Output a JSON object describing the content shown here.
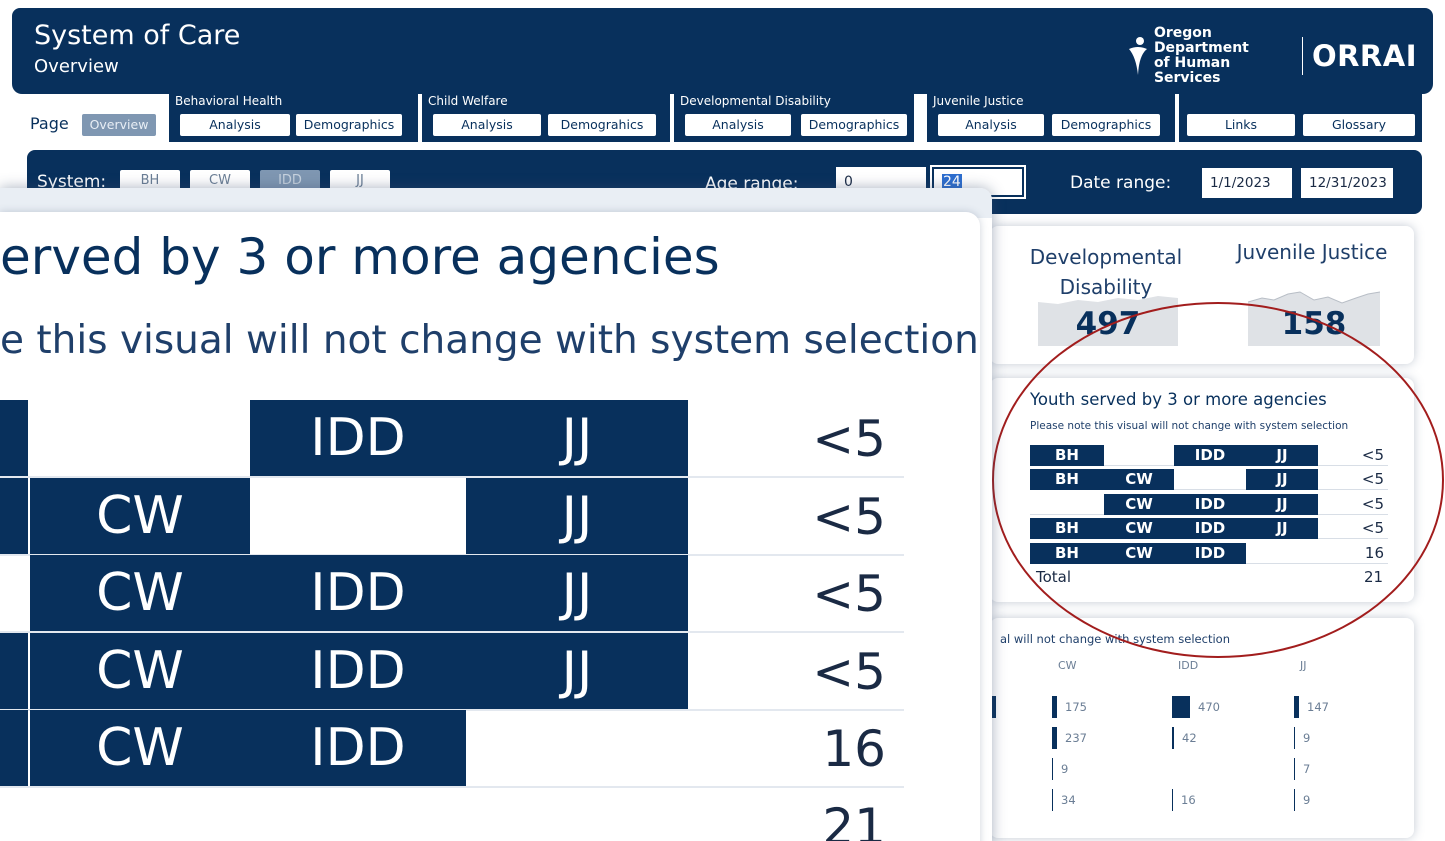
{
  "header": {
    "title": "System of Care",
    "subtitle": "Overview",
    "agency_line1": "Oregon Department",
    "agency_line2": "of Human Services",
    "brand": "ORRAI"
  },
  "nav": {
    "page_label": "Page",
    "overview": "Overview",
    "groups": [
      {
        "label": "Behavioral Health",
        "buttons": [
          "Analysis",
          "Demographics"
        ]
      },
      {
        "label": "Child Welfare",
        "buttons": [
          "Analysis",
          "Demograhics"
        ]
      },
      {
        "label": "Developmental Disability",
        "buttons": [
          "Analysis",
          "Demographics"
        ]
      },
      {
        "label": "Juvenile Justice",
        "buttons": [
          "Analysis",
          "Demographics"
        ]
      }
    ],
    "links": "Links",
    "glossary": "Glossary"
  },
  "filters": {
    "system_label": "System:",
    "systems": [
      "BH",
      "CW",
      "IDD",
      "JJ"
    ],
    "age_label": "Age range:",
    "age_min": "0",
    "age_max": "24",
    "date_label": "Date range:",
    "date_start": "1/1/2023",
    "date_end": "12/31/2023"
  },
  "kpis": [
    {
      "label_line1": "Developmental",
      "label_line2": "Disability",
      "value": "497"
    },
    {
      "label_line1": "Juvenile Justice",
      "label_line2": "",
      "value": "158"
    }
  ],
  "youth": {
    "title": "Youth served by 3 or more agencies",
    "note": "Please note this visual will not change with system selection",
    "rows": [
      {
        "cells": [
          "BH",
          "",
          "IDD",
          "JJ"
        ],
        "count": "<5"
      },
      {
        "cells": [
          "BH",
          "CW",
          "",
          "JJ"
        ],
        "count": "<5"
      },
      {
        "cells": [
          "",
          "CW",
          "IDD",
          "JJ"
        ],
        "count": "<5"
      },
      {
        "cells": [
          "BH",
          "CW",
          "IDD",
          "JJ"
        ],
        "count": "<5"
      },
      {
        "cells": [
          "BH",
          "CW",
          "IDD",
          ""
        ],
        "count": "16"
      }
    ],
    "total_label": "Total",
    "total_value": "21"
  },
  "zoom": {
    "title": "erved by 3 or more agencies",
    "note": "e this visual will not change with system selection",
    "rows": [
      {
        "cells": [
          "",
          "",
          "IDD",
          "JJ"
        ],
        "first_on": true,
        "count": "<5"
      },
      {
        "cells": [
          "",
          "CW",
          "",
          "JJ"
        ],
        "first_on": true,
        "count": "<5"
      },
      {
        "cells": [
          "",
          "CW",
          "IDD",
          "JJ"
        ],
        "first_on": false,
        "count": "<5"
      },
      {
        "cells": [
          "",
          "CW",
          "IDD",
          "JJ"
        ],
        "first_on": true,
        "count": "<5"
      },
      {
        "cells": [
          "",
          "CW",
          "IDD",
          ""
        ],
        "first_on": true,
        "count": "16"
      }
    ],
    "total_value": "21"
  },
  "bottom": {
    "note": "al will not change with system selection",
    "columns": [
      {
        "name": "CW",
        "values": [
          "175",
          "237",
          "9",
          "34"
        ]
      },
      {
        "name": "IDD",
        "values": [
          "470",
          "42",
          "",
          "16"
        ]
      },
      {
        "name": "JJ",
        "values": [
          "147",
          "9",
          "7",
          "9"
        ]
      }
    ]
  },
  "colors": {
    "navy": "#08305c",
    "highlight_circle": "#a21d1d",
    "disabled_pill": "#7f97b2"
  }
}
